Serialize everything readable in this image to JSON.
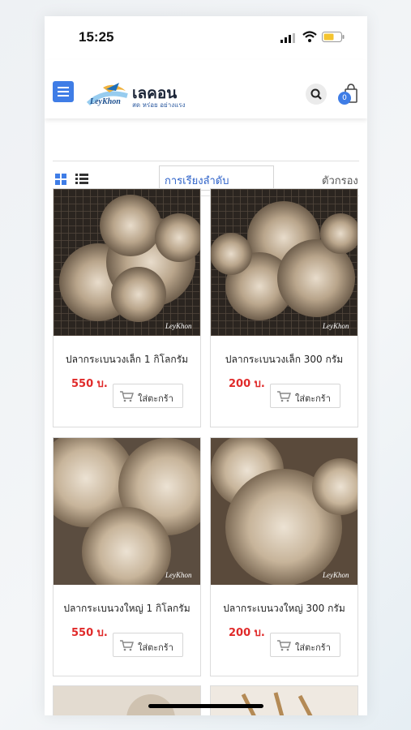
{
  "status_bar": {
    "time": "15:25"
  },
  "header": {
    "brand_name": "เลคอน",
    "brand_tagline": "สด หร่อย อย่างแรง",
    "logo_text": "LeyKhon",
    "cart_count": "0"
  },
  "toolbar": {
    "sort_label": "การเรียงลำดับ",
    "filter_label": "ตัวกรอง"
  },
  "products": [
    {
      "name": "ปลากระเบนวงเล็ก 1 กิโลกรัม",
      "price": "550 บ.",
      "add_label": "ใส่ตะกร้า"
    },
    {
      "name": "ปลากระเบนวงเล็ก 300 กรัม",
      "price": "200 บ.",
      "add_label": "ใส่ตะกร้า"
    },
    {
      "name": "ปลากระเบนวงใหญ่ 1 กิโลกรัม",
      "price": "550 บ.",
      "add_label": "ใส่ตะกร้า"
    },
    {
      "name": "ปลากระเบนวงใหญ่ 300 กรัม",
      "price": "200 บ.",
      "add_label": "ใส่ตะกร้า"
    }
  ],
  "colors": {
    "accent": "#3f7de6",
    "price": "#e02a2a"
  }
}
